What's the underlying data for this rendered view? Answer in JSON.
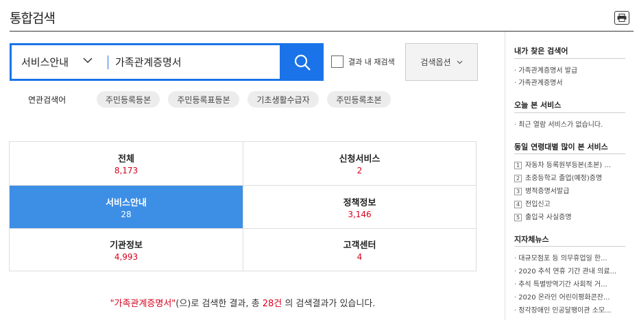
{
  "page": {
    "title": "통합검색"
  },
  "search": {
    "category": "서비스안내",
    "query": "가족관계증명서",
    "recheck_label": "결과 내 재검색",
    "options_label": "검색옵션"
  },
  "related": {
    "label": "연관검색어",
    "chips": [
      "주민등록등본",
      "주민등록표등본",
      "기초생활수급자",
      "주민등록초본"
    ]
  },
  "categories": [
    {
      "name": "전체",
      "count": "8,173"
    },
    {
      "name": "신청서비스",
      "count": "2"
    },
    {
      "name": "서비스안내",
      "count": "28"
    },
    {
      "name": "정책정보",
      "count": "3,146"
    },
    {
      "name": "기관정보",
      "count": "4,993"
    },
    {
      "name": "고객센터",
      "count": "4"
    }
  ],
  "result": {
    "query_quoted": "\"가족관계증명서\"",
    "text1": "(으)로 검색한 결과, 총 ",
    "count": "28건",
    "text2": " 의 검색결과가 있습니다."
  },
  "sidebar": {
    "my_searches": {
      "title": "내가 찾은 검색어",
      "items": [
        "가족관계증명서 발급",
        "가족관계증명서"
      ]
    },
    "recent": {
      "title": "오늘 본 서비스",
      "items": [
        "최근 열람 서비스가 없습니다."
      ]
    },
    "popular": {
      "title": "동일 연령대별 많이 본 서비스",
      "items": [
        {
          "rank": "1",
          "label": "자동차 등록원부등본(초본) ..."
        },
        {
          "rank": "2",
          "label": "초중등학교 졸업(예정)증명"
        },
        {
          "rank": "3",
          "label": "병적증명서발급"
        },
        {
          "rank": "4",
          "label": "전입신고"
        },
        {
          "rank": "5",
          "label": "출입국 사실증명"
        }
      ]
    },
    "news": {
      "title": "지자체뉴스",
      "items": [
        "대규모점포 등 의무휴업일 한...",
        "2020 추석 연휴 기간 관내 의료...",
        "추석 특별방역기간 사회적 거...",
        "2020 온라인 어린이평화콘잔...",
        "정각장애인 인공달팽이관 소모..."
      ]
    }
  },
  "colors": {
    "accent": "#1a73e8",
    "active_tab": "#3d8fe6",
    "count_red": "#d6001c"
  }
}
